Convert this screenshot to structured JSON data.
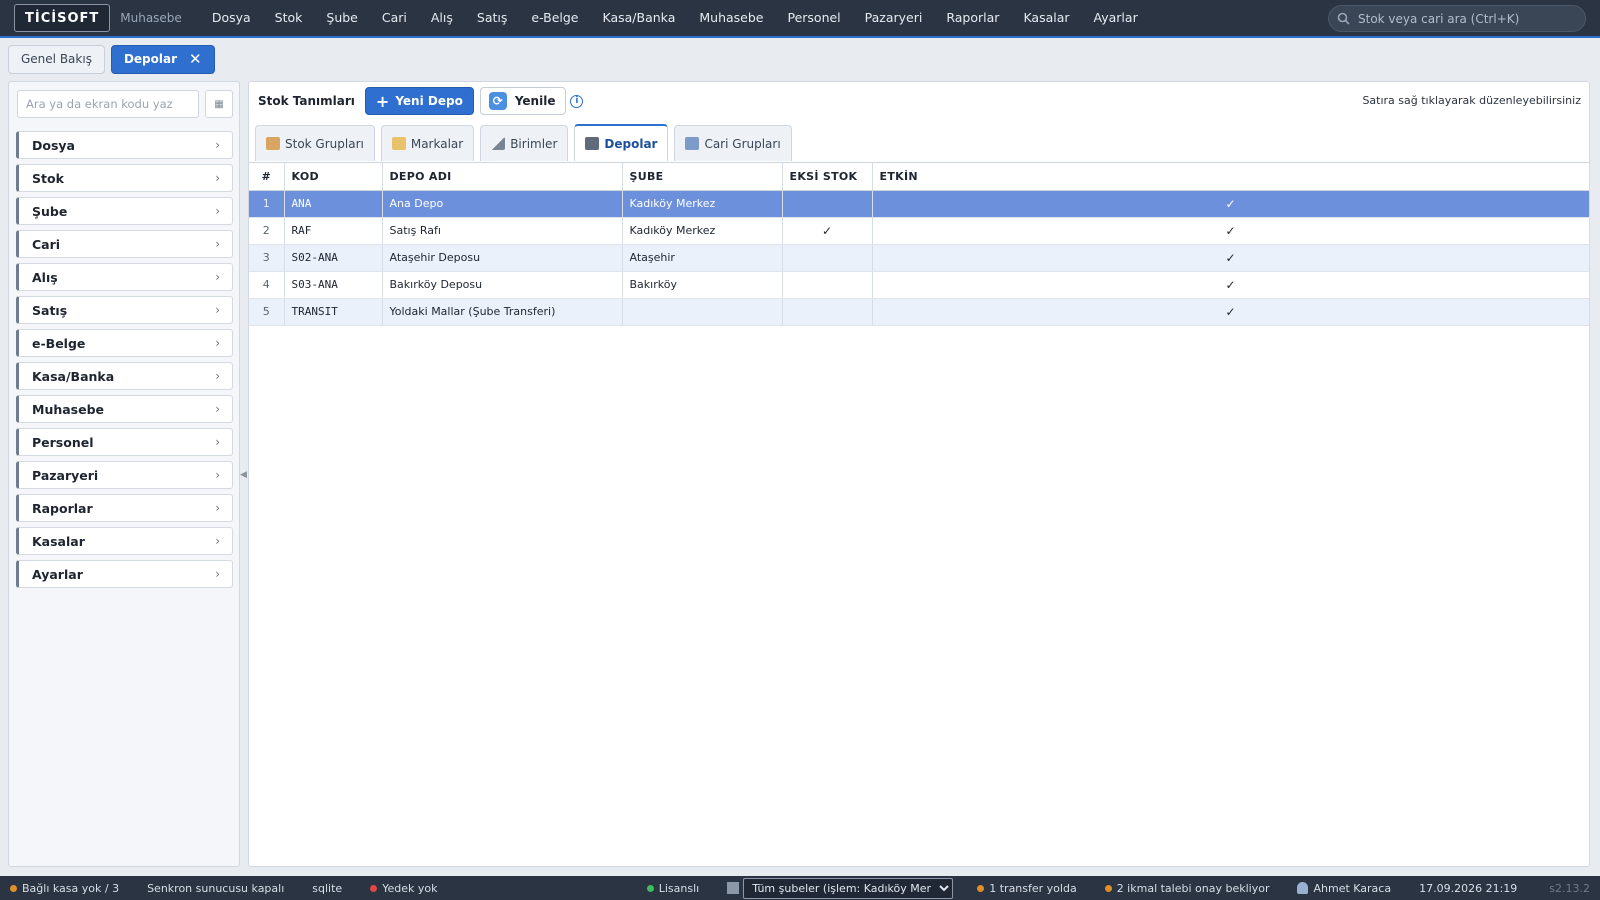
{
  "app": {
    "logo": "TİCİSOFT",
    "module": "Muhasebe"
  },
  "menu": [
    "Dosya",
    "Stok",
    "Şube",
    "Cari",
    "Alış",
    "Satış",
    "e-Belge",
    "Kasa/Banka",
    "Muhasebe",
    "Personel",
    "Pazaryeri",
    "Raporlar",
    "Kasalar",
    "Ayarlar"
  ],
  "search": {
    "placeholder": "Stok veya cari ara (Ctrl+K)"
  },
  "doc_tabs": [
    {
      "label": "Genel Bakış",
      "active": false
    },
    {
      "label": "Depolar",
      "active": true
    }
  ],
  "sidebar": {
    "search_placeholder": "Ara ya da ekran kodu yaz",
    "grid_button": "▦",
    "items": [
      "Dosya",
      "Stok",
      "Şube",
      "Cari",
      "Alış",
      "Satış",
      "e-Belge",
      "Kasa/Banka",
      "Muhasebe",
      "Personel",
      "Pazaryeri",
      "Raporlar",
      "Kasalar",
      "Ayarlar"
    ]
  },
  "toolbar": {
    "title": "Stok Tanımları",
    "new_label": "Yeni Depo",
    "refresh_label": "Yenile",
    "hint": "Satıra sağ tıklayarak düzenleyebilirsiniz"
  },
  "subtabs": [
    {
      "label": "Stok Grupları",
      "icon": "box-icon",
      "active": false
    },
    {
      "label": "Markalar",
      "icon": "tag-icon",
      "active": false
    },
    {
      "label": "Birimler",
      "icon": "ruler-icon",
      "active": false
    },
    {
      "label": "Depolar",
      "icon": "warehouse-icon",
      "active": true
    },
    {
      "label": "Cari Grupları",
      "icon": "users-icon",
      "active": false
    }
  ],
  "table": {
    "columns": [
      "#",
      "KOD",
      "DEPO ADI",
      "ŞUBE",
      "EKSİ STOK",
      "ETKİN"
    ],
    "rows": [
      {
        "no": "1",
        "kod": "ANA",
        "depo_adi": "Ana Depo",
        "sube": "Kadıköy Merkez",
        "eksi_stok": "",
        "etkin": "✓",
        "selected": true
      },
      {
        "no": "2",
        "kod": "RAF",
        "depo_adi": "Satış Rafı",
        "sube": "Kadıköy Merkez",
        "eksi_stok": "✓",
        "etkin": "✓",
        "selected": false
      },
      {
        "no": "3",
        "kod": "S02-ANA",
        "depo_adi": "Ataşehir Deposu",
        "sube": "Ataşehir",
        "eksi_stok": "",
        "etkin": "✓",
        "selected": false
      },
      {
        "no": "4",
        "kod": "S03-ANA",
        "depo_adi": "Bakırköy Deposu",
        "sube": "Bakırköy",
        "eksi_stok": "",
        "etkin": "✓",
        "selected": false
      },
      {
        "no": "5",
        "kod": "TRANSIT",
        "depo_adi": "Yoldaki Mallar (Şube Transferi)",
        "sube": "",
        "eksi_stok": "",
        "etkin": "✓",
        "selected": false
      }
    ]
  },
  "status": {
    "kasa": "Bağlı kasa yok / 3",
    "sync": "Senkron sunucusu kapalı",
    "db": "sqlite",
    "backup": "Yedek yok",
    "license": "Lisanslı",
    "branch_selected": "Tüm şubeler (işlem: Kadıköy Merkez)",
    "transfer": "1 transfer yolda",
    "requests": "2 ikmal talebi onay bekliyor",
    "user": "Ahmet Karaca",
    "datetime": "17.09.2026 21:19",
    "version": "s2.13.2"
  },
  "colors": {
    "accent": "#2f6fd0",
    "topbar": "#2a3442",
    "selected_row": "#6d90dd",
    "dot_orange": "#e0902a",
    "dot_red": "#e04848",
    "dot_green": "#3bbf5a"
  }
}
